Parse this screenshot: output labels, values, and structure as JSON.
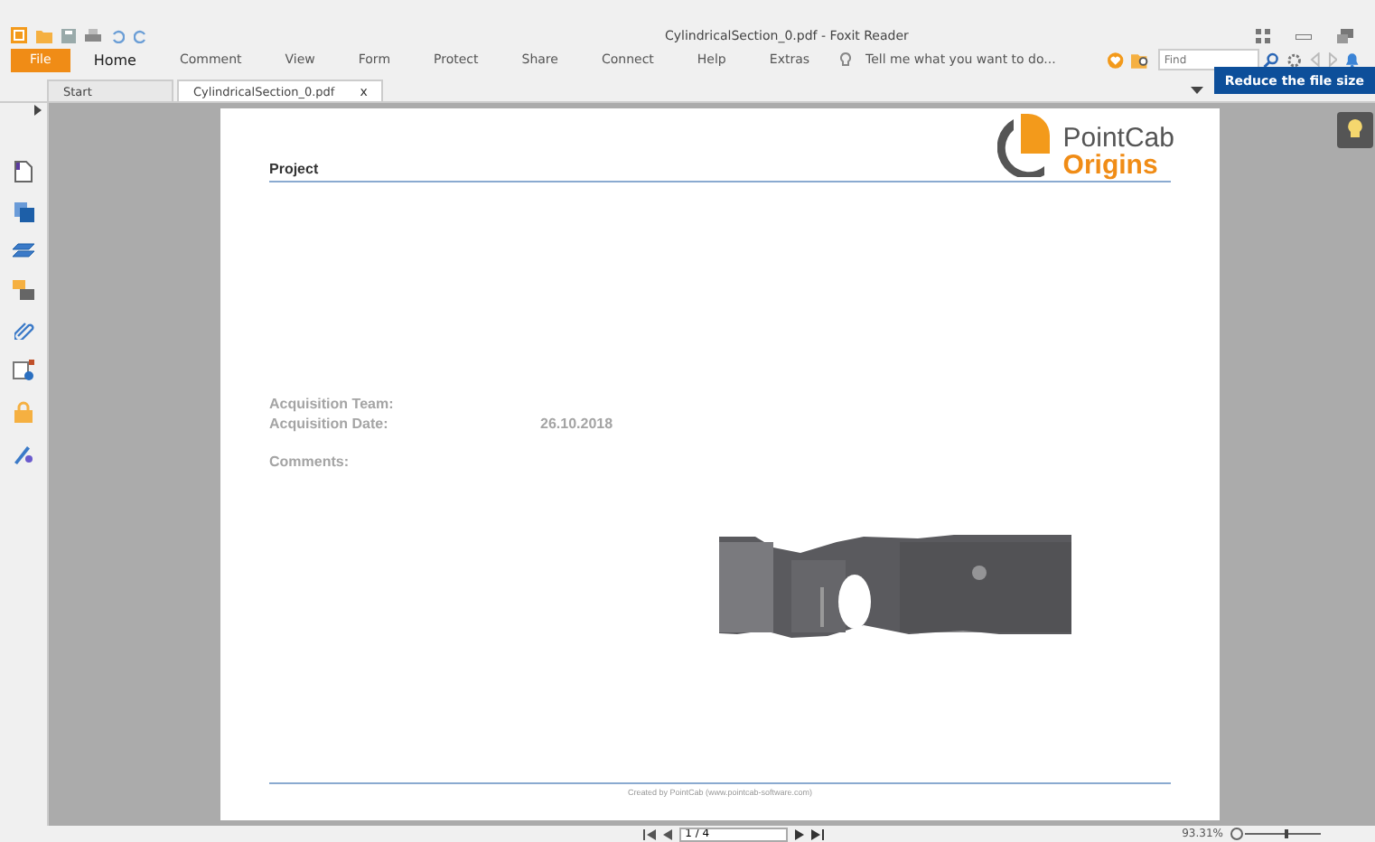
{
  "window": {
    "title": "CylindricalSection_0.pdf - Foxit Reader"
  },
  "menu": [
    {
      "label": "File",
      "kind": "file",
      "selected": false
    },
    {
      "label": "Home",
      "kind": "tab",
      "selected": true
    },
    {
      "label": "Comment",
      "kind": "tab",
      "selected": false
    },
    {
      "label": "View",
      "kind": "tab",
      "selected": false
    },
    {
      "label": "Form",
      "kind": "tab",
      "selected": false
    },
    {
      "label": "Protect",
      "kind": "tab",
      "selected": false
    },
    {
      "label": "Share",
      "kind": "tab",
      "selected": false
    },
    {
      "label": "Connect",
      "kind": "tab",
      "selected": false
    },
    {
      "label": "Help",
      "kind": "tab",
      "selected": false
    },
    {
      "label": "Extras",
      "kind": "tab",
      "selected": false
    }
  ],
  "tell_me": {
    "placeholder": "Tell me what you want to do..."
  },
  "find": {
    "placeholder": "Find"
  },
  "promo_button": "Reduce the file size",
  "tabs": [
    {
      "label": "Start",
      "selected": false
    },
    {
      "label": "CylindricalSection_0.pdf",
      "selected": true,
      "close": "x"
    }
  ],
  "document": {
    "logo": {
      "name": "PointCab",
      "subtitle": "Origins"
    },
    "heading": "Project",
    "fields": [
      {
        "label": "Acquisition Team:"
      },
      {
        "label": "Acquisition Date:",
        "value": "26.10.2018"
      }
    ],
    "comments_label": "Comments:",
    "footer": "Created by PointCab (www.pointcab-software.com)"
  },
  "status_bar": {
    "page": "1 / 4",
    "zoom": "93.31%"
  }
}
